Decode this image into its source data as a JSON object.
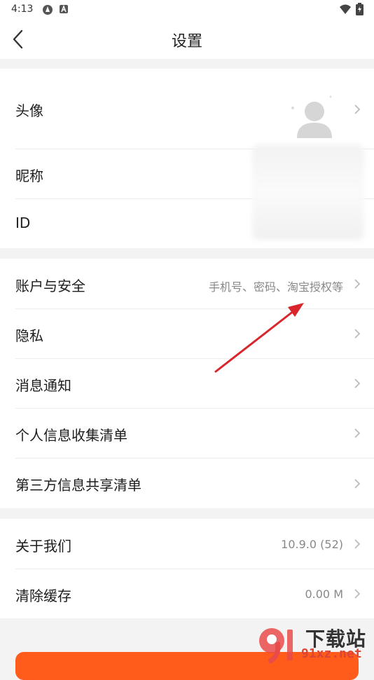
{
  "status_bar": {
    "time": "4:13"
  },
  "header": {
    "title": "设置"
  },
  "profile": {
    "avatar_label": "头像",
    "nickname_label": "昵称",
    "id_label": "ID"
  },
  "settings": {
    "account_security": {
      "label": "账户与安全",
      "value": "手机号、密码、淘宝授权等"
    },
    "privacy": {
      "label": "隐私"
    },
    "notifications": {
      "label": "消息通知"
    },
    "personal_info_list": {
      "label": "个人信息收集清单"
    },
    "third_party_list": {
      "label": "第三方信息共享清单"
    }
  },
  "about": {
    "label": "关于我们",
    "value": "10.9.0 (52)"
  },
  "cache": {
    "label": "清除缓存",
    "value": "0.00 M"
  },
  "watermark": {
    "text_cn": "下载站",
    "url": "91xz.net"
  },
  "colors": {
    "accent": "#ff5b1a",
    "annotation_arrow": "#d9262c"
  }
}
